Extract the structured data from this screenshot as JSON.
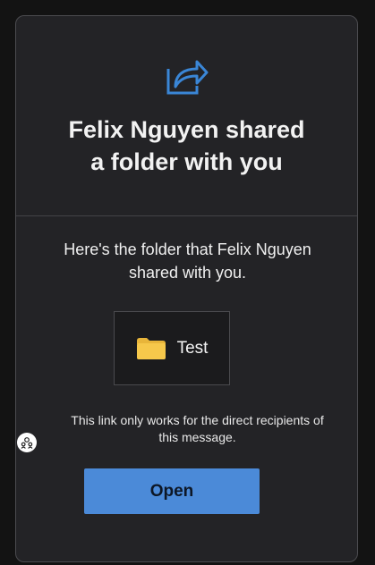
{
  "header": {
    "icon": "share-icon",
    "title_line1": "Felix Nguyen shared",
    "title_line2": "a folder with you"
  },
  "message": {
    "line1": "Here's the folder that Felix Nguyen",
    "line2": "shared with you."
  },
  "folder": {
    "icon": "folder-icon",
    "name": "Test"
  },
  "notice": {
    "line1": "This link only works for the direct recipients of",
    "line2": "this message."
  },
  "actions": {
    "open_label": "Open"
  },
  "colors": {
    "accent": "#4b8ad8",
    "share_icon": "#3a86d6",
    "folder": "#f4c44a",
    "card_background": "#232326",
    "page_background": "#131313"
  },
  "side_badge": {
    "icon": "people-icon"
  }
}
